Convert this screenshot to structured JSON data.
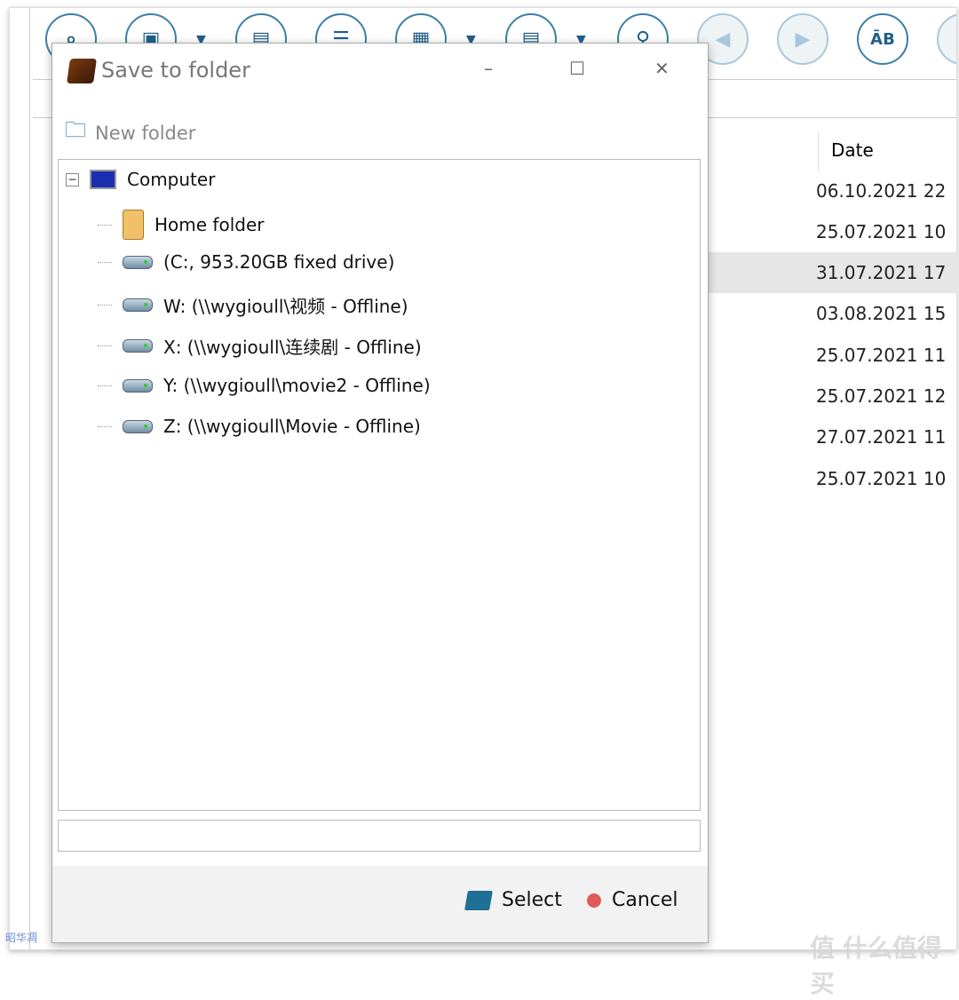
{
  "toolbar": {
    "buttons": [
      "search-icon",
      "save-icon",
      "save-as-icon",
      "checklist-icon",
      "layout-icon",
      "list-icon",
      "binoculars-icon",
      "previous-icon",
      "next-icon",
      "case-icon"
    ],
    "case_label": "ĀB"
  },
  "file_list": {
    "date_header": "Date",
    "dates": [
      "06.10.2021 22",
      "25.07.2021 10",
      "31.07.2021 17",
      "03.08.2021 15",
      "25.07.2021 11",
      "25.07.2021 12",
      "27.07.2021 11",
      "25.07.2021 10"
    ],
    "selected_index": 2
  },
  "dialog": {
    "title": "Save to folder",
    "new_folder": "New folder",
    "tree": {
      "root": "Computer",
      "items": [
        "Home folder",
        " (C:, 953.20GB fixed drive)",
        "W: (\\\\wygioull\\视频 - Offline)",
        "X: (\\\\wygioull\\连续剧 - Offline)",
        "Y: (\\\\wygioull\\movie2 - Offline)",
        "Z: (\\\\wygioull\\Movie - Offline)"
      ]
    },
    "path_value": "",
    "select": "Select",
    "cancel": "Cancel",
    "accent": "#1f6f96",
    "cancel_color": "#e05a5a"
  },
  "watermarks": {
    "left": "昭华凋",
    "right": "值 什么值得买"
  }
}
